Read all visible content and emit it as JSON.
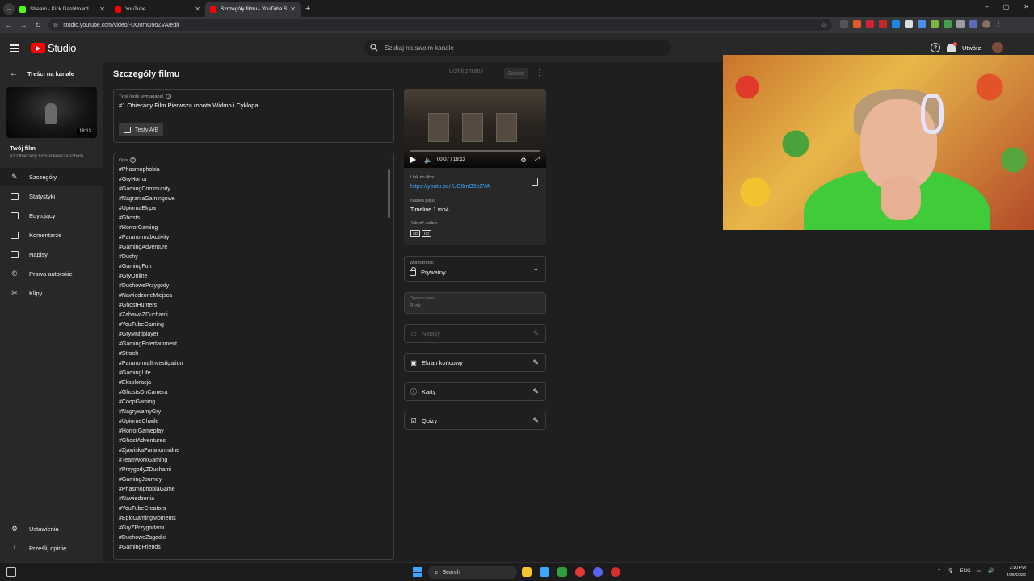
{
  "browser": {
    "tabs": [
      {
        "title": "Stream - Kick Dashboard",
        "color": "#53fc18",
        "active": false
      },
      {
        "title": "YouTube",
        "color": "#ff0000",
        "active": false
      },
      {
        "title": "Szczegóły filmu - YouTube Studio",
        "color": "#ff0000",
        "active": true
      }
    ],
    "url": "studio.youtube.com/video/-UO0mO9oZVA/edit"
  },
  "header": {
    "logo": "Studio",
    "search_placeholder": "Szukaj na swoim kanale",
    "create_label": "Utwórz"
  },
  "sidebar": {
    "back_label": "Treści na kanale",
    "thumb_duration": "18:13",
    "your_film": "Twój film",
    "your_film_sub": "#1 Obiecany Film Pierwsza robota ...",
    "items": [
      {
        "label": "Szczegóły",
        "icon": "pencil-icon",
        "active": true
      },
      {
        "label": "Statystyki",
        "icon": "analytics-icon",
        "active": false
      },
      {
        "label": "Edytujący",
        "icon": "editor-icon",
        "active": false
      },
      {
        "label": "Komentarze",
        "icon": "comments-icon",
        "active": false
      },
      {
        "label": "Napisy",
        "icon": "subtitles-icon",
        "active": false
      },
      {
        "label": "Prawa autorskie",
        "icon": "copyright-icon",
        "active": false
      },
      {
        "label": "Klipy",
        "icon": "scissors-icon",
        "active": false
      }
    ],
    "settings_label": "Ustawienia",
    "feedback_label": "Prześlij opinię"
  },
  "main": {
    "page_title": "Szczegóły filmu",
    "undo_label": "Cofnij zmiany",
    "save_label": "Zapisz",
    "title_label": "Tytuł (pole wymagane)",
    "title_value": "#1 Obiecany Film Pierwsza robota Widmo i Cyklopa",
    "ab_label": "Testy A/B",
    "desc_label": "Opis",
    "tags": [
      "#Phasmophobia",
      "#GryHorror",
      "#GamingCommunity",
      "#NagraniaGamingowe",
      "#UpiornaEkipa",
      "#Ghosts",
      "#HorrorGaming",
      "#ParanormalActivity",
      "#GamingAdventure",
      "#Duchy",
      "#GamingFun",
      "#GryOnline",
      "#DuchowePrzygody",
      "#NawiedzoneMiejsca",
      "#GhostHunters",
      "#ZabawaZDuchami",
      "#YouTubeGaming",
      "#GryMultiplayer",
      "#GamingEntertainment",
      "#Strach",
      "#ParanormalInvestigation",
      "#GamingLife",
      "#Eksploracja",
      "#GhostsOnCamera",
      "#CoopGaming",
      "#NagrywamyGry",
      "#UpiorneChwile",
      "#HorrorGameplay",
      "#GhostAdventures",
      "#ZjawiskaParanormalne",
      "#TeamworkGaming",
      "#PrzygodyZDuchami",
      "#GamingJourney",
      "#PhasmophobiaGame",
      "#Nawiedzenia",
      "#YouTubeCreators",
      "#EpicGamingMoments",
      "#GryZPrzygodami",
      "#DuchoweZagadki",
      "#GamingFriends"
    ]
  },
  "video": {
    "time": "00:07 / 18:13",
    "link_label": "Link do filmu",
    "link": "https://youtu.be/-UO0mO9oZVA",
    "file_label": "Nazwa pliku",
    "file": "Timeline 1.mp4",
    "quality_label": "Jakość wideo",
    "quality": [
      "SD",
      "HD"
    ]
  },
  "settings": {
    "visibility_label": "Widoczność",
    "visibility": "Prywatny",
    "restrictions_label": "Ograniczenia",
    "restrictions": "Brak",
    "subtitles": "Napisy",
    "endscreen": "Ekran końcowy",
    "cards": "Karty",
    "quiz": "Quizy"
  },
  "taskbar": {
    "search": "Search",
    "lang": "ENG",
    "time": "3:10 PM",
    "date": "4/25/2026"
  }
}
